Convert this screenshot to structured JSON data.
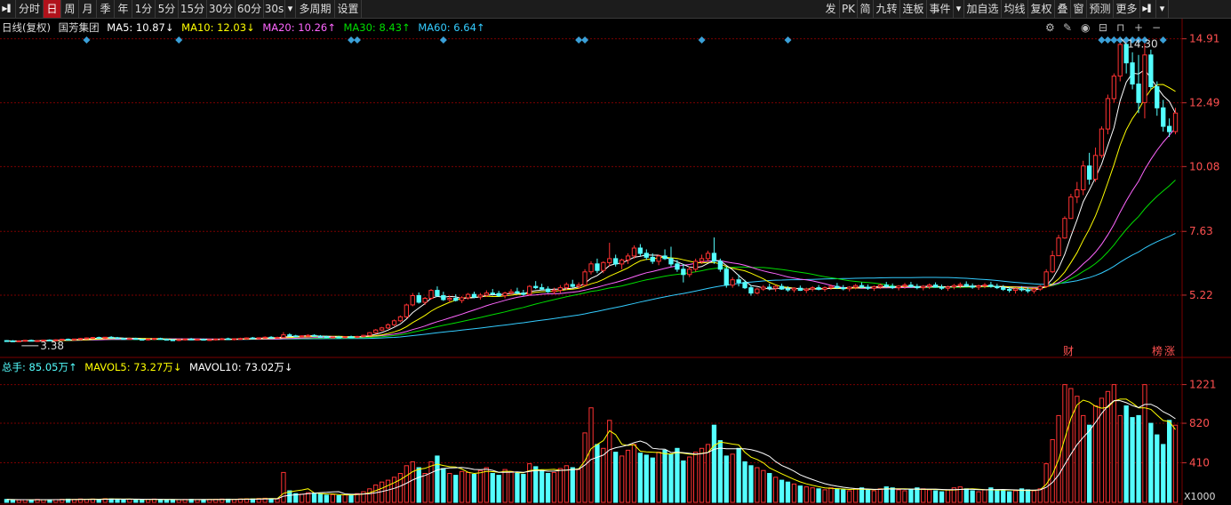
{
  "toolbar": {
    "left": [
      "分时",
      "日",
      "周",
      "月",
      "季",
      "年",
      "1分",
      "5分",
      "15分",
      "30分",
      "60分",
      "30s",
      "多周期",
      "设置"
    ],
    "active": "日",
    "right": [
      "发",
      "PK",
      "简",
      "九转",
      "连板",
      "事件",
      "加自选",
      "均线",
      "复权",
      "叠",
      "窗",
      "预测",
      "更多"
    ]
  },
  "price_legend": {
    "period": "日线(复权)",
    "name": "国芳集团",
    "ma5": "MA5: 10.87↓",
    "ma10": "MA10: 12.03↓",
    "ma20": "MA20: 10.26↑",
    "ma30": "MA30: 8.43↑",
    "ma60": "MA60: 6.64↑"
  },
  "volume_legend": {
    "total": "总手: 85.05万↑",
    "mavol5": "MAVOL5: 73.27万↓",
    "mavol10": "MAVOL10: 73.02万↓"
  },
  "colors": {
    "up": "#ff3232",
    "down": "#54ffff",
    "ma5": "#ffffff",
    "ma10": "#ffff00",
    "ma20": "#ff66ff",
    "ma30": "#00dd00",
    "ma60": "#33ccff",
    "grid": "#7a0000",
    "marker": "#3aa0d8",
    "accent": "#b0121b"
  },
  "chart_data": {
    "type": "candlestick",
    "price_axis_ticks": [
      "14.91",
      "12.49",
      "10.08",
      "7.63",
      "5.22"
    ],
    "price_ylim": [
      3.0,
      15.2
    ],
    "volume_axis_ticks": [
      "1221",
      "820",
      "410"
    ],
    "volume_unit": "X1000",
    "volume_ylim": [
      0,
      1300
    ],
    "annotations": {
      "high": "14.30",
      "low": "3.38",
      "cai": "财",
      "bang": "榜",
      "zhang": "涨"
    },
    "candles": [
      [
        3.5,
        3.52,
        3.46,
        3.49
      ],
      [
        3.49,
        3.52,
        3.45,
        3.47
      ],
      [
        3.47,
        3.51,
        3.44,
        3.49
      ],
      [
        3.49,
        3.53,
        3.46,
        3.51
      ],
      [
        3.51,
        3.54,
        3.47,
        3.48
      ],
      [
        3.48,
        3.52,
        3.45,
        3.5
      ],
      [
        3.5,
        3.53,
        3.46,
        3.52
      ],
      [
        3.52,
        3.55,
        3.49,
        3.51
      ],
      [
        3.51,
        3.55,
        3.48,
        3.53
      ],
      [
        3.53,
        3.57,
        3.5,
        3.55
      ],
      [
        3.55,
        3.58,
        3.51,
        3.53
      ],
      [
        3.53,
        3.57,
        3.5,
        3.56
      ],
      [
        3.56,
        3.6,
        3.52,
        3.58
      ],
      [
        3.58,
        3.62,
        3.55,
        3.6
      ],
      [
        3.6,
        3.64,
        3.56,
        3.62
      ],
      [
        3.62,
        3.65,
        3.58,
        3.6
      ],
      [
        3.6,
        3.64,
        3.56,
        3.63
      ],
      [
        3.63,
        3.67,
        3.59,
        3.61
      ],
      [
        3.61,
        3.64,
        3.57,
        3.58
      ],
      [
        3.58,
        3.61,
        3.54,
        3.56
      ],
      [
        3.56,
        3.6,
        3.53,
        3.58
      ],
      [
        3.58,
        3.61,
        3.55,
        3.55
      ],
      [
        3.55,
        3.58,
        3.51,
        3.53
      ],
      [
        3.53,
        3.57,
        3.5,
        3.56
      ],
      [
        3.56,
        3.6,
        3.52,
        3.58
      ],
      [
        3.58,
        3.61,
        3.54,
        3.55
      ],
      [
        3.55,
        3.58,
        3.51,
        3.53
      ],
      [
        3.53,
        3.56,
        3.49,
        3.51
      ],
      [
        3.51,
        3.55,
        3.48,
        3.54
      ],
      [
        3.54,
        3.58,
        3.5,
        3.56
      ],
      [
        3.56,
        3.6,
        3.52,
        3.53
      ],
      [
        3.53,
        3.57,
        3.5,
        3.55
      ],
      [
        3.55,
        3.58,
        3.51,
        3.52
      ],
      [
        3.52,
        3.56,
        3.49,
        3.54
      ],
      [
        3.54,
        3.58,
        3.5,
        3.56
      ],
      [
        3.56,
        3.6,
        3.52,
        3.57
      ],
      [
        3.57,
        3.61,
        3.53,
        3.55
      ],
      [
        3.55,
        3.59,
        3.51,
        3.57
      ],
      [
        3.57,
        3.61,
        3.53,
        3.58
      ],
      [
        3.58,
        3.62,
        3.54,
        3.6
      ],
      [
        3.6,
        3.64,
        3.56,
        3.58
      ],
      [
        3.58,
        3.62,
        3.54,
        3.61
      ],
      [
        3.61,
        3.66,
        3.57,
        3.63
      ],
      [
        3.63,
        3.67,
        3.59,
        3.61
      ],
      [
        3.61,
        3.65,
        3.57,
        3.62
      ],
      [
        3.62,
        3.82,
        3.6,
        3.72
      ],
      [
        3.72,
        3.78,
        3.66,
        3.68
      ],
      [
        3.68,
        3.72,
        3.63,
        3.66
      ],
      [
        3.66,
        3.7,
        3.62,
        3.68
      ],
      [
        3.68,
        3.74,
        3.64,
        3.7
      ],
      [
        3.7,
        3.74,
        3.66,
        3.67
      ],
      [
        3.67,
        3.71,
        3.63,
        3.65
      ],
      [
        3.65,
        3.69,
        3.6,
        3.62
      ],
      [
        3.62,
        3.66,
        3.58,
        3.64
      ],
      [
        3.64,
        3.68,
        3.6,
        3.62
      ],
      [
        3.62,
        3.66,
        3.58,
        3.65
      ],
      [
        3.65,
        3.69,
        3.61,
        3.63
      ],
      [
        3.63,
        3.68,
        3.59,
        3.66
      ],
      [
        3.66,
        3.72,
        3.62,
        3.7
      ],
      [
        3.7,
        3.82,
        3.66,
        3.8
      ],
      [
        3.8,
        3.94,
        3.76,
        3.9
      ],
      [
        3.9,
        4.02,
        3.86,
        3.98
      ],
      [
        3.98,
        4.15,
        3.94,
        4.1
      ],
      [
        4.1,
        4.3,
        4.05,
        4.25
      ],
      [
        4.25,
        4.45,
        4.2,
        4.4
      ],
      [
        4.4,
        4.9,
        4.35,
        4.85
      ],
      [
        4.85,
        5.3,
        4.8,
        5.2
      ],
      [
        5.2,
        5.32,
        4.9,
        4.95
      ],
      [
        4.95,
        5.15,
        4.85,
        5.1
      ],
      [
        5.1,
        5.45,
        5.05,
        5.4
      ],
      [
        5.4,
        5.55,
        5.15,
        5.2
      ],
      [
        5.2,
        5.35,
        5.0,
        5.05
      ],
      [
        5.05,
        5.2,
        4.95,
        5.1
      ],
      [
        5.1,
        5.25,
        4.98,
        5.02
      ],
      [
        5.02,
        5.18,
        4.92,
        5.12
      ],
      [
        5.12,
        5.3,
        5.05,
        5.25
      ],
      [
        5.25,
        5.35,
        5.1,
        5.15
      ],
      [
        5.15,
        5.3,
        5.05,
        5.22
      ],
      [
        5.22,
        5.4,
        5.15,
        5.3
      ],
      [
        5.3,
        5.45,
        5.2,
        5.28
      ],
      [
        5.28,
        5.38,
        5.15,
        5.2
      ],
      [
        5.2,
        5.35,
        5.1,
        5.3
      ],
      [
        5.3,
        5.45,
        5.22,
        5.35
      ],
      [
        5.35,
        5.5,
        5.25,
        5.3
      ],
      [
        5.3,
        5.42,
        5.2,
        5.25
      ],
      [
        5.25,
        5.6,
        5.2,
        5.55
      ],
      [
        5.55,
        5.75,
        5.45,
        5.5
      ],
      [
        5.5,
        5.65,
        5.4,
        5.45
      ],
      [
        5.45,
        5.55,
        5.3,
        5.35
      ],
      [
        5.35,
        5.5,
        5.25,
        5.4
      ],
      [
        5.4,
        5.6,
        5.3,
        5.5
      ],
      [
        5.5,
        5.7,
        5.42,
        5.62
      ],
      [
        5.62,
        5.8,
        5.5,
        5.55
      ],
      [
        5.55,
        5.7,
        5.45,
        5.6
      ],
      [
        5.6,
        6.2,
        5.55,
        6.1
      ],
      [
        6.1,
        6.5,
        6.0,
        6.4
      ],
      [
        6.4,
        6.6,
        6.05,
        6.15
      ],
      [
        6.15,
        6.5,
        6.05,
        6.45
      ],
      [
        6.45,
        7.2,
        6.3,
        6.6
      ],
      [
        6.6,
        6.75,
        6.3,
        6.4
      ],
      [
        6.4,
        6.6,
        6.2,
        6.55
      ],
      [
        6.55,
        6.8,
        6.4,
        6.7
      ],
      [
        6.7,
        7.1,
        6.6,
        7.0
      ],
      [
        7.0,
        7.15,
        6.7,
        6.8
      ],
      [
        6.8,
        6.95,
        6.55,
        6.65
      ],
      [
        6.65,
        6.8,
        6.4,
        6.5
      ],
      [
        6.5,
        6.75,
        6.35,
        6.7
      ],
      [
        6.7,
        6.95,
        6.55,
        6.6
      ],
      [
        6.6,
        7.05,
        6.3,
        6.4
      ],
      [
        6.4,
        6.55,
        6.1,
        6.2
      ],
      [
        6.2,
        6.4,
        5.7,
        6.0
      ],
      [
        6.0,
        6.3,
        5.9,
        6.2
      ],
      [
        6.2,
        6.6,
        6.1,
        6.5
      ],
      [
        6.5,
        6.75,
        6.4,
        6.6
      ],
      [
        6.6,
        6.9,
        6.5,
        6.8
      ],
      [
        6.8,
        7.4,
        6.4,
        6.5
      ],
      [
        6.5,
        6.6,
        6.1,
        6.2
      ],
      [
        6.2,
        6.3,
        5.5,
        5.6
      ],
      [
        5.6,
        5.9,
        5.5,
        5.8
      ],
      [
        5.8,
        6.0,
        5.55,
        5.7
      ],
      [
        5.7,
        5.8,
        5.45,
        5.5
      ],
      [
        5.5,
        5.6,
        5.2,
        5.3
      ],
      [
        5.3,
        5.5,
        5.25,
        5.45
      ],
      [
        5.45,
        5.6,
        5.38,
        5.52
      ],
      [
        5.52,
        5.65,
        5.4,
        5.48
      ],
      [
        5.48,
        5.6,
        5.35,
        5.55
      ],
      [
        5.55,
        5.65,
        5.42,
        5.45
      ],
      [
        5.45,
        5.55,
        5.35,
        5.42
      ],
      [
        5.42,
        5.52,
        5.32,
        5.48
      ],
      [
        5.48,
        5.58,
        5.38,
        5.4
      ],
      [
        5.4,
        5.5,
        5.3,
        5.45
      ],
      [
        5.45,
        5.56,
        5.36,
        5.5
      ],
      [
        5.5,
        5.6,
        5.4,
        5.44
      ],
      [
        5.44,
        5.55,
        5.35,
        5.5
      ],
      [
        5.5,
        5.62,
        5.42,
        5.55
      ],
      [
        5.55,
        5.68,
        5.45,
        5.5
      ],
      [
        5.5,
        5.6,
        5.4,
        5.46
      ],
      [
        5.46,
        5.56,
        5.36,
        5.52
      ],
      [
        5.52,
        5.64,
        5.44,
        5.58
      ],
      [
        5.58,
        5.7,
        5.48,
        5.52
      ],
      [
        5.52,
        5.62,
        5.42,
        5.48
      ],
      [
        5.48,
        5.58,
        5.38,
        5.54
      ],
      [
        5.54,
        5.66,
        5.45,
        5.6
      ],
      [
        5.6,
        5.72,
        5.5,
        5.55
      ],
      [
        5.55,
        5.66,
        5.45,
        5.5
      ],
      [
        5.5,
        5.6,
        5.4,
        5.56
      ],
      [
        5.56,
        5.68,
        5.46,
        5.6
      ],
      [
        5.6,
        5.72,
        5.5,
        5.54
      ],
      [
        5.54,
        5.64,
        5.44,
        5.5
      ],
      [
        5.5,
        5.6,
        5.4,
        5.55
      ],
      [
        5.55,
        5.66,
        5.45,
        5.6
      ],
      [
        5.6,
        5.7,
        5.5,
        5.52
      ],
      [
        5.52,
        5.62,
        5.42,
        5.48
      ],
      [
        5.48,
        5.58,
        5.38,
        5.53
      ],
      [
        5.53,
        5.64,
        5.44,
        5.58
      ],
      [
        5.58,
        5.7,
        5.48,
        5.62
      ],
      [
        5.62,
        5.74,
        5.52,
        5.56
      ],
      [
        5.56,
        5.66,
        5.46,
        5.52
      ],
      [
        5.52,
        5.62,
        5.42,
        5.57
      ],
      [
        5.57,
        5.68,
        5.48,
        5.6
      ],
      [
        5.6,
        5.72,
        5.5,
        5.55
      ],
      [
        5.55,
        5.65,
        5.45,
        5.5
      ],
      [
        5.5,
        5.6,
        5.38,
        5.44
      ],
      [
        5.44,
        5.54,
        5.32,
        5.4
      ],
      [
        5.4,
        5.5,
        5.28,
        5.46
      ],
      [
        5.46,
        5.56,
        5.36,
        5.42
      ],
      [
        5.42,
        5.52,
        5.3,
        5.38
      ],
      [
        5.38,
        5.5,
        5.28,
        5.45
      ],
      [
        5.45,
        5.6,
        5.38,
        5.55
      ],
      [
        5.55,
        6.2,
        5.5,
        6.1
      ],
      [
        6.1,
        6.9,
        6.05,
        6.71
      ],
      [
        6.71,
        7.5,
        6.7,
        7.38
      ],
      [
        7.38,
        8.2,
        7.35,
        8.12
      ],
      [
        8.12,
        9.05,
        8.1,
        8.93
      ],
      [
        8.93,
        9.5,
        8.7,
        9.2
      ],
      [
        9.2,
        10.3,
        9.0,
        10.1
      ],
      [
        10.1,
        10.6,
        9.4,
        9.6
      ],
      [
        9.6,
        10.8,
        9.5,
        10.5
      ],
      [
        10.5,
        11.6,
        10.4,
        11.5
      ],
      [
        11.5,
        12.8,
        11.3,
        12.65
      ],
      [
        12.65,
        13.6,
        12.5,
        13.5
      ],
      [
        13.5,
        14.91,
        13.3,
        14.7
      ],
      [
        14.7,
        14.8,
        13.6,
        14.0
      ],
      [
        14.0,
        14.4,
        13.0,
        13.2
      ],
      [
        13.2,
        14.3,
        12.1,
        12.5
      ],
      [
        12.5,
        14.9,
        11.9,
        14.3
      ],
      [
        14.3,
        14.5,
        13.0,
        13.1
      ],
      [
        13.1,
        13.3,
        12.0,
        12.3
      ],
      [
        12.3,
        12.6,
        11.4,
        11.6
      ],
      [
        11.6,
        11.9,
        11.2,
        11.4
      ],
      [
        11.4,
        12.3,
        11.3,
        12.1
      ]
    ],
    "volume": [
      30,
      28,
      25,
      27,
      24,
      30,
      28,
      26,
      29,
      31,
      33,
      30,
      35,
      32,
      34,
      30,
      38,
      36,
      33,
      30,
      32,
      28,
      26,
      31,
      34,
      29,
      27,
      25,
      28,
      30,
      31,
      29,
      27,
      30,
      32,
      34,
      33,
      30,
      35,
      37,
      36,
      40,
      42,
      38,
      36,
      310,
      120,
      90,
      85,
      100,
      95,
      85,
      75,
      80,
      70,
      78,
      82,
      90,
      110,
      140,
      180,
      210,
      230,
      260,
      300,
      380,
      420,
      360,
      300,
      420,
      480,
      350,
      300,
      280,
      320,
      310,
      290,
      330,
      360,
      300,
      280,
      340,
      320,
      300,
      290,
      400,
      370,
      330,
      300,
      310,
      350,
      380,
      360,
      340,
      720,
      980,
      600,
      560,
      850,
      520,
      480,
      540,
      600,
      510,
      490,
      460,
      520,
      540,
      500,
      560,
      430,
      470,
      520,
      560,
      600,
      800,
      640,
      480,
      500,
      560,
      420,
      380,
      360,
      330,
      300,
      260,
      230,
      210,
      190,
      170,
      160,
      150,
      140,
      130,
      150,
      140,
      130,
      120,
      140,
      150,
      130,
      120,
      140,
      160,
      150,
      130,
      120,
      130,
      150,
      140,
      130,
      120,
      110,
      130,
      150,
      160,
      140,
      120,
      110,
      130,
      150,
      130,
      120,
      110,
      120,
      140,
      130,
      120,
      140,
      400,
      650,
      900,
      1221,
      1180,
      1100,
      900,
      800,
      1000,
      1080,
      1150,
      1221,
      900,
      1000,
      880,
      900,
      1221,
      820,
      700,
      600,
      850,
      800
    ],
    "volume_up": [],
    "markers": [
      "◆",
      "◆",
      "◆◆",
      "◆",
      "◆◆",
      "◆",
      "◆",
      "◆",
      "◆◆",
      "◆◆◆◆◆◆◆◆",
      "◆"
    ]
  }
}
